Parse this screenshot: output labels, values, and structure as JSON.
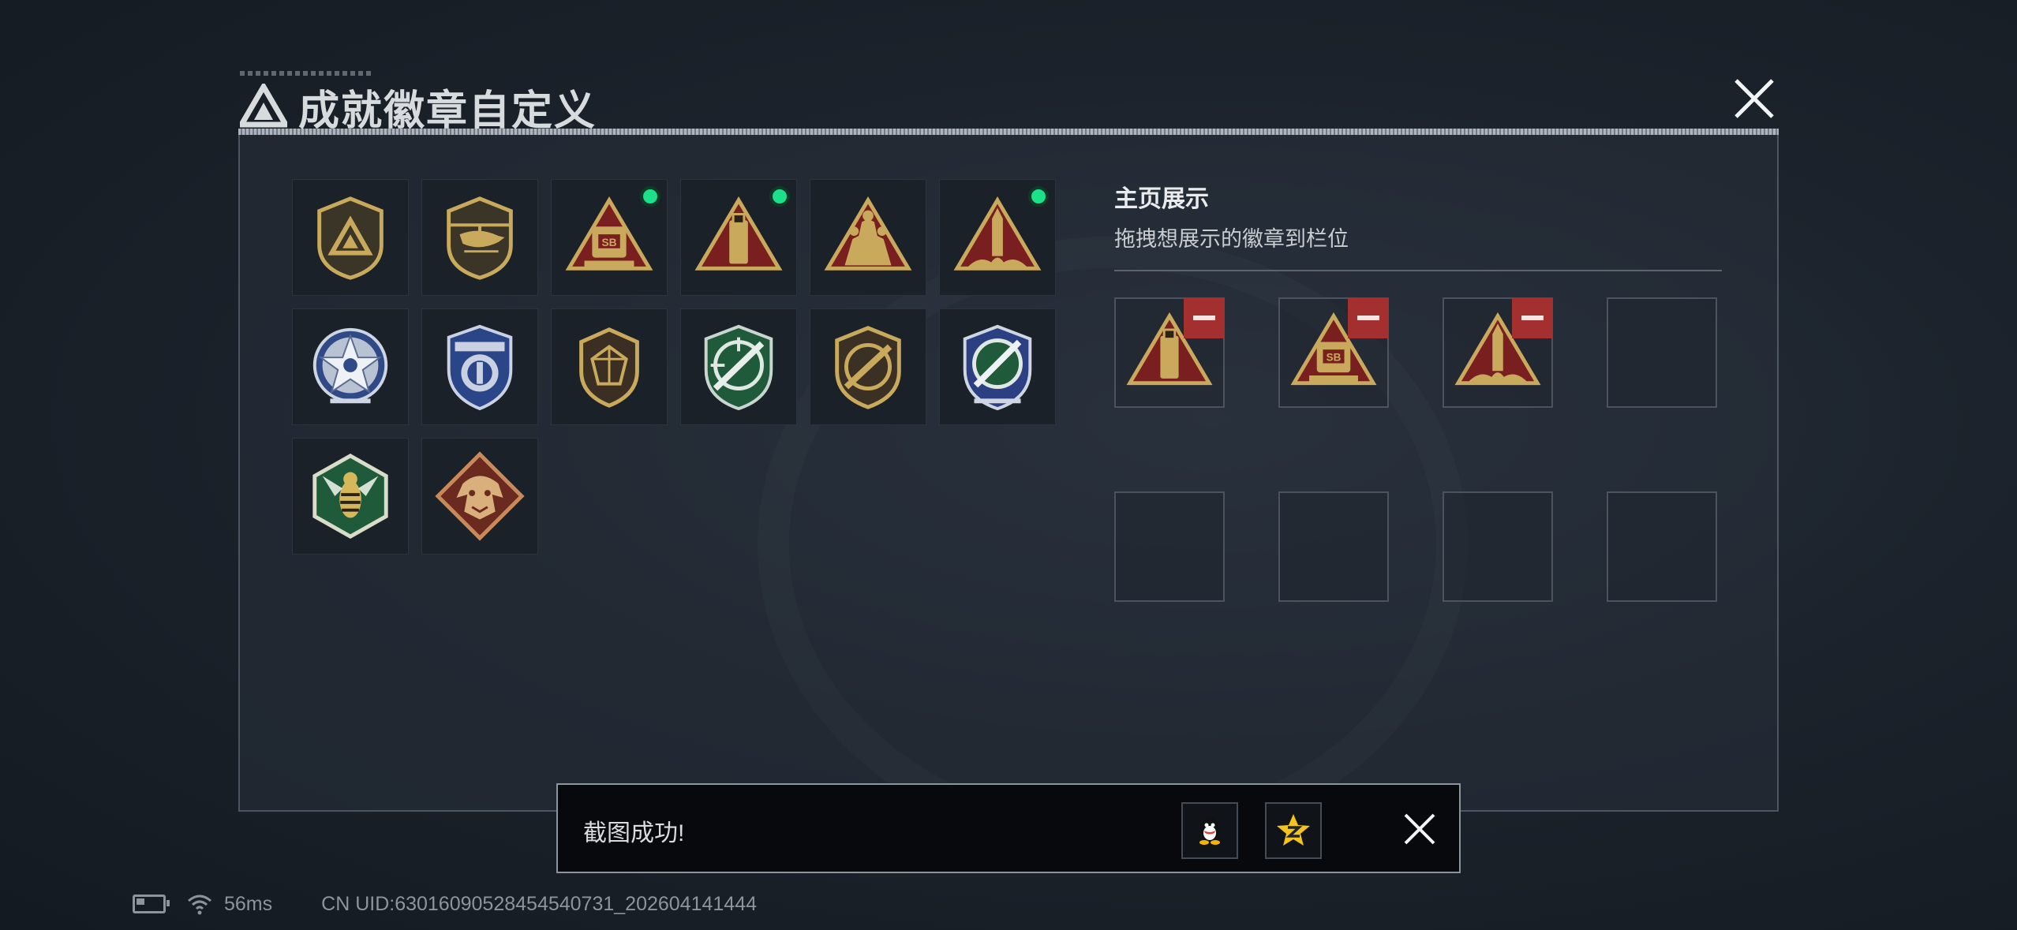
{
  "header": {
    "title": "成就徽章自定义"
  },
  "badges": [
    {
      "icon": "triangle-shield-badge-icon",
      "new": false
    },
    {
      "icon": "helicopter-badge-icon",
      "new": false
    },
    {
      "icon": "sb-truck-triangle-badge-icon",
      "new": true
    },
    {
      "icon": "usb-triangle-badge-icon",
      "new": true
    },
    {
      "icon": "soldiers-triangle-badge-icon",
      "new": false
    },
    {
      "icon": "missile-triangle-badge-icon",
      "new": true
    },
    {
      "icon": "star-wreath-badge-icon",
      "new": false
    },
    {
      "icon": "police-shield-badge-icon",
      "new": false
    },
    {
      "icon": "gem-shield-badge-icon",
      "new": false
    },
    {
      "icon": "green-rifle-shield-badge-icon",
      "new": false
    },
    {
      "icon": "rifle-shield-badge-icon",
      "new": false
    },
    {
      "icon": "blue-rifle-shield-badge-icon",
      "new": false
    },
    {
      "icon": "wasp-hexagon-badge-icon",
      "new": false
    },
    {
      "icon": "dragon-diamond-badge-icon",
      "new": false
    }
  ],
  "showcase": {
    "title": "主页展示",
    "subtitle": "拖拽想展示的徽章到栏位",
    "slots": [
      {
        "icon": "usb-triangle-badge-icon"
      },
      {
        "icon": "sb-truck-triangle-badge-icon"
      },
      {
        "icon": "missile-triangle-badge-icon"
      },
      {
        "icon": ""
      },
      {
        "icon": ""
      },
      {
        "icon": ""
      },
      {
        "icon": ""
      },
      {
        "icon": ""
      }
    ]
  },
  "toast": {
    "message": "截图成功!",
    "share_buttons": [
      "qq-icon",
      "qzone-icon"
    ]
  },
  "status_bar": {
    "ping": "56ms",
    "uid": "CN UID:6301609052845454073​1_202604141444"
  }
}
